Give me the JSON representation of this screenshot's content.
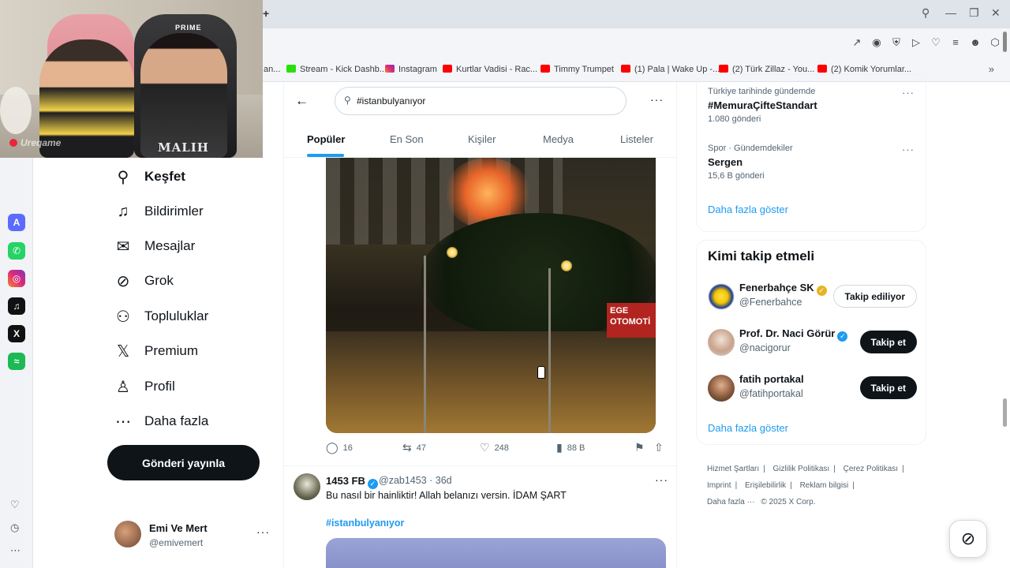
{
  "browser": {
    "new_tab": "+",
    "bookmarks": [
      {
        "label": "an...",
        "icon": "none"
      },
      {
        "label": "Stream - Kick Dashb...",
        "icon": "kick"
      },
      {
        "label": "Instagram",
        "icon": "instagram"
      },
      {
        "label": "Kurtlar Vadisi - Rac...",
        "icon": "youtube"
      },
      {
        "label": "Timmy Trumpet",
        "icon": "youtube"
      },
      {
        "label": "(1) Pala | Wake Up -...",
        "icon": "youtube"
      },
      {
        "label": "(2) Türk Zillaz - You...",
        "icon": "youtube"
      },
      {
        "label": "(2) Komik Yorumlar...",
        "icon": "youtube"
      }
    ]
  },
  "webcam": {
    "chair_brand": "PRIME",
    "shirt_text": "MALIH",
    "logo_text": "Ureqame"
  },
  "nav": {
    "items": [
      {
        "label": "Keşfet",
        "icon": "search-icon",
        "active": true
      },
      {
        "label": "Bildirimler",
        "icon": "bell-icon"
      },
      {
        "label": "Mesajlar",
        "icon": "mail-icon"
      },
      {
        "label": "Grok",
        "icon": "grok-icon"
      },
      {
        "label": "Topluluklar",
        "icon": "communities-icon"
      },
      {
        "label": "Premium",
        "icon": "x-logo-icon"
      },
      {
        "label": "Profil",
        "icon": "profile-icon"
      },
      {
        "label": "Daha fazla",
        "icon": "more-circle-icon"
      }
    ],
    "post_button": "Gönderi yayınla",
    "account": {
      "name": "Emi Ve Mert",
      "handle": "@emivemert"
    }
  },
  "search": {
    "query": "#istanbulyanıyor"
  },
  "tabs": [
    {
      "label": "Popüler",
      "active": true
    },
    {
      "label": "En Son"
    },
    {
      "label": "Kişiler"
    },
    {
      "label": "Medya"
    },
    {
      "label": "Listeler"
    }
  ],
  "tweet1": {
    "media": {
      "sign_line1": "EGE",
      "sign_line2": "OTOMOTİ"
    },
    "actions": {
      "replies": "16",
      "reposts": "47",
      "likes": "248",
      "views": "88 B"
    }
  },
  "tweet2": {
    "name": "1453 FB",
    "handle": "@zab1453 · 36d",
    "text": "Bu nasıl bir hainliktir! Allah belanızı versin. İDAM ŞART",
    "hashtag": "#istanbulyanıyor"
  },
  "trends": [
    {
      "meta": "Türkiye tarihinde gündemde",
      "title": "#MemuraÇifteStandart",
      "count": "1.080 gönderi"
    },
    {
      "meta": "Spor · Gündemdekiler",
      "title": "Sergen",
      "count": "15,6 B gönderi"
    }
  ],
  "trends_show_more": "Daha fazla göster",
  "who_to_follow": {
    "title": "Kimi takip etmeli",
    "accounts": [
      {
        "name": "Fenerbahçe SK",
        "handle": "@Fenerbahce",
        "button": "Takip ediliyor",
        "badge": "gold"
      },
      {
        "name": "Prof. Dr. Naci Görür",
        "handle": "@nacigorur",
        "button": "Takip et",
        "badge": "blue"
      },
      {
        "name": "fatih portakal",
        "handle": "@fatihportakal",
        "button": "Takip et",
        "badge": "none"
      }
    ],
    "show_more": "Daha fazla göster"
  },
  "footer": {
    "links": [
      "Hizmet Şartları",
      "Gizlilik Politikası",
      "Çerez Politikası",
      "Imprint",
      "Erişilebilirlik",
      "Reklam bilgisi",
      "Daha fazla ···"
    ],
    "copyright": "© 2025 X Corp."
  },
  "colors": {
    "accent": "#1d9bf0",
    "text": "#0f1419",
    "muted": "#536471"
  }
}
